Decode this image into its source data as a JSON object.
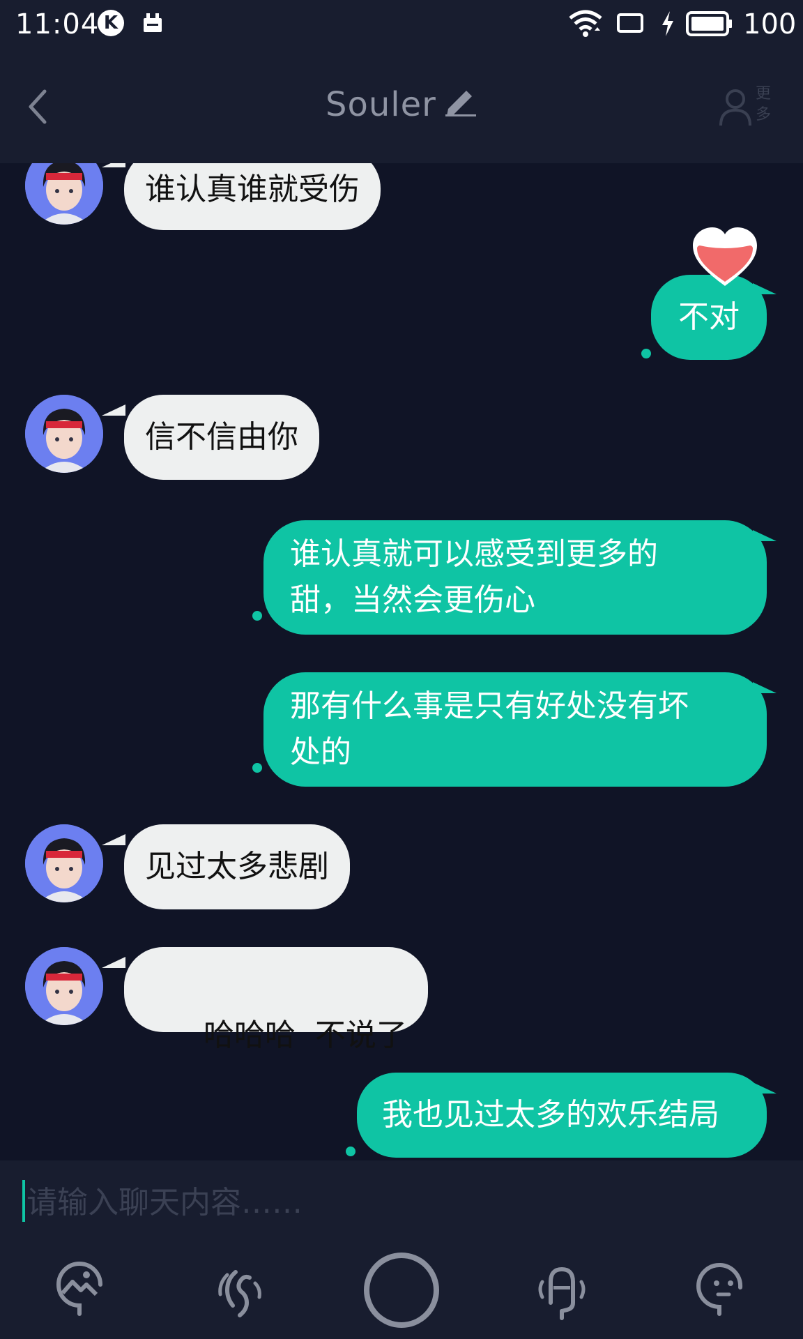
{
  "status_bar": {
    "time": "11:04",
    "k_badge": "K",
    "battery": "100",
    "icons": [
      "k-icon",
      "notification-icon",
      "wifi-icon",
      "screen-icon",
      "charging-icon",
      "battery-icon"
    ]
  },
  "header": {
    "title": "Souler",
    "more_label_1": "更",
    "more_label_2": "多",
    "icons": [
      "back-icon",
      "edit-icon",
      "person-icon"
    ]
  },
  "messages": [
    {
      "from": "other",
      "text": "谁认真谁就受伤"
    },
    {
      "from": "me",
      "text": "不对",
      "sticker": "heart-icon"
    },
    {
      "from": "other",
      "text": "信不信由你"
    },
    {
      "from": "me",
      "line1": "谁认真就可以感受到更多的",
      "line2": "甜，当然会更伤心"
    },
    {
      "from": "me",
      "line1": "那有什么事是只有好处没有坏",
      "line2": "处的"
    },
    {
      "from": "other",
      "text": "见过太多悲剧"
    },
    {
      "from": "other",
      "text": "哈哈哈  不说了"
    },
    {
      "from": "me",
      "text": "我也见过太多的欢乐结局"
    }
  ],
  "input": {
    "placeholder": "请输入聊天内容……",
    "value": ""
  },
  "toolbar": {
    "icons": [
      "image-icon",
      "voice-call-icon",
      "record-button",
      "voice-change-icon",
      "emoji-icon"
    ]
  },
  "colors": {
    "background": "#101426",
    "bar": "#181d2f",
    "accent": "#0fc4a4",
    "incoming_bubble": "#eef0f0"
  }
}
